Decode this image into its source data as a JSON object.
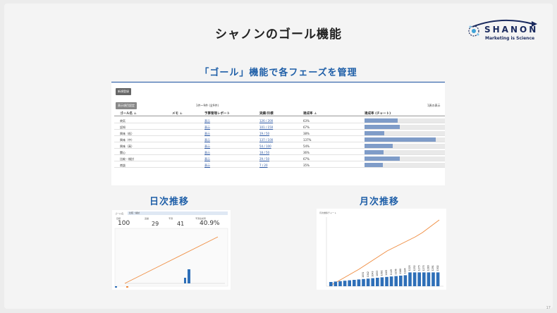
{
  "slide": {
    "title": "シャノンのゴール機能",
    "subtitle": "「ゴール」機能で各フェーズを管理",
    "page_number": "17"
  },
  "logo": {
    "name": "SHANON",
    "tagline": "Marketing is Science"
  },
  "goal_table": {
    "new_button": "新規登録",
    "toggle_button": "表示項目設定",
    "range_text": "1件～9件 (全9件)",
    "per_page": "1頁の表示",
    "columns": [
      "ゴール名 ⊥",
      "メモ ⊥",
      "予算管理レポート",
      "実績/目標",
      "達成率 ⊥",
      "達成率 (チャート)"
    ],
    "rows": [
      {
        "name": "商気",
        "report": "表示",
        "actual_goal": "126 / 200",
        "rate": "63%",
        "rate_value": 63
      },
      {
        "name": "認知",
        "report": "表示",
        "actual_goal": "101 / 150",
        "rate": "67%",
        "rate_value": 67
      },
      {
        "name": "興味（低）",
        "report": "表示",
        "actual_goal": "19 / 50",
        "rate": "38%",
        "rate_value": 38
      },
      {
        "name": "興味（中）",
        "report": "表示",
        "actual_goal": "137 / 100",
        "rate": "137%",
        "rate_value": 137
      },
      {
        "name": "興味（高）",
        "report": "表示",
        "actual_goal": "54 / 100",
        "rate": "54%",
        "rate_value": 54
      },
      {
        "name": "関心",
        "report": "表示",
        "actual_goal": "18 / 50",
        "rate": "36%",
        "rate_value": 36
      },
      {
        "name": "比較・検討",
        "report": "表示",
        "actual_goal": "29 / 50",
        "rate": "67%",
        "rate_value": 67
      },
      {
        "name": "商談",
        "report": "表示",
        "actual_goal": "7 / 20",
        "rate": "35%",
        "rate_value": 35
      }
    ]
  },
  "daily": {
    "heading": "日次推移",
    "goal_label": "ゴール名：",
    "goal_value": "比較・検討",
    "stats": [
      "100",
      "29",
      "41",
      "40.9%"
    ],
    "stat_labels": [
      "目標",
      "実績",
      "予測",
      "予測達成率"
    ]
  },
  "monthly": {
    "heading": "月次推移",
    "chart_title": "月次推移チャート",
    "bar_labels": [
      "1031",
      "1042",
      "1043",
      "1053",
      "1092",
      "1105",
      "1149",
      "1156",
      "1168",
      "1184",
      "1225",
      "1232",
      "1275",
      "1275",
      "1280",
      "1291",
      "1302"
    ]
  },
  "colors": {
    "accent": "#1f5fa8",
    "bar_blue": "#2e6fb8",
    "line_orange": "#ef8a3c",
    "rate_bar": "#7f9cc8"
  }
}
